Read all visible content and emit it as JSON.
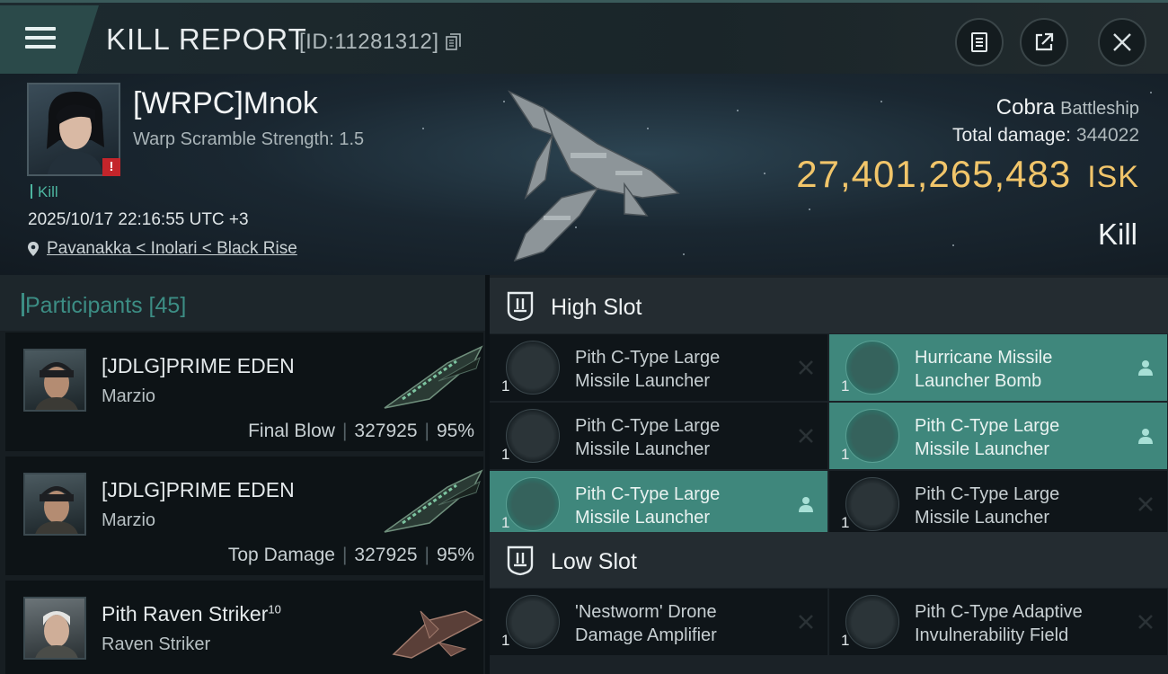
{
  "header": {
    "title": "KILL REPORT",
    "id_label": "[ID:11281312]"
  },
  "victim": {
    "name": "[WRPC]Mnok",
    "warp_scramble": "Warp Scramble Strength: 1.5",
    "kill_tag": "Kill",
    "datetime": "2025/10/17 22:16:55 UTC +3",
    "location": "Pavanakka < Inolari < Black Rise",
    "ship_name": "Cobra",
    "ship_class": "Battleship",
    "total_damage_label": "Total damage:",
    "total_damage": "344022",
    "isk_value": "27,401,265,483",
    "isk_unit": "ISK",
    "result": "Kill"
  },
  "participants": {
    "title": "Participants [45]",
    "rows": [
      {
        "name": "[JDLG]PRIME EDEN",
        "sup": "",
        "ship": "Marzio",
        "role": "Final Blow",
        "damage": "327925",
        "percent": "95%"
      },
      {
        "name": "[JDLG]PRIME EDEN",
        "sup": "",
        "ship": "Marzio",
        "role": "Top Damage",
        "damage": "327925",
        "percent": "95%"
      },
      {
        "name": "Pith Raven Striker",
        "sup": "10",
        "ship": "Raven Striker",
        "role": "",
        "damage": "",
        "percent": ""
      }
    ]
  },
  "fitting": {
    "high_slot_label": "High Slot",
    "low_slot_label": "Low Slot",
    "high": [
      {
        "qty": "1",
        "name_line1": "Pith C-Type Large",
        "name_line2": "Missile Launcher",
        "state": "destroyed"
      },
      {
        "qty": "1",
        "name_line1": "Hurricane Missile",
        "name_line2": "Launcher Bomb",
        "state": "dropped"
      },
      {
        "qty": "1",
        "name_line1": "Pith C-Type Large",
        "name_line2": "Missile Launcher",
        "state": "destroyed"
      },
      {
        "qty": "1",
        "name_line1": "Pith C-Type Large",
        "name_line2": "Missile Launcher",
        "state": "dropped"
      },
      {
        "qty": "1",
        "name_line1": "Pith C-Type Large",
        "name_line2": "Missile Launcher",
        "state": "dropped"
      },
      {
        "qty": "1",
        "name_line1": "Pith C-Type Large",
        "name_line2": "Missile Launcher",
        "state": "destroyed"
      }
    ],
    "low": [
      {
        "qty": "1",
        "name_line1": "'Nestworm' Drone",
        "name_line2": "Damage Amplifier",
        "state": "destroyed"
      },
      {
        "qty": "1",
        "name_line1": "Pith C-Type Adaptive",
        "name_line2": "Invulnerability Field",
        "state": "destroyed"
      }
    ]
  },
  "colors": {
    "accent_teal": "#3f877c",
    "isk_gold": "#f1c56a",
    "warning_red": "#c4252b"
  }
}
